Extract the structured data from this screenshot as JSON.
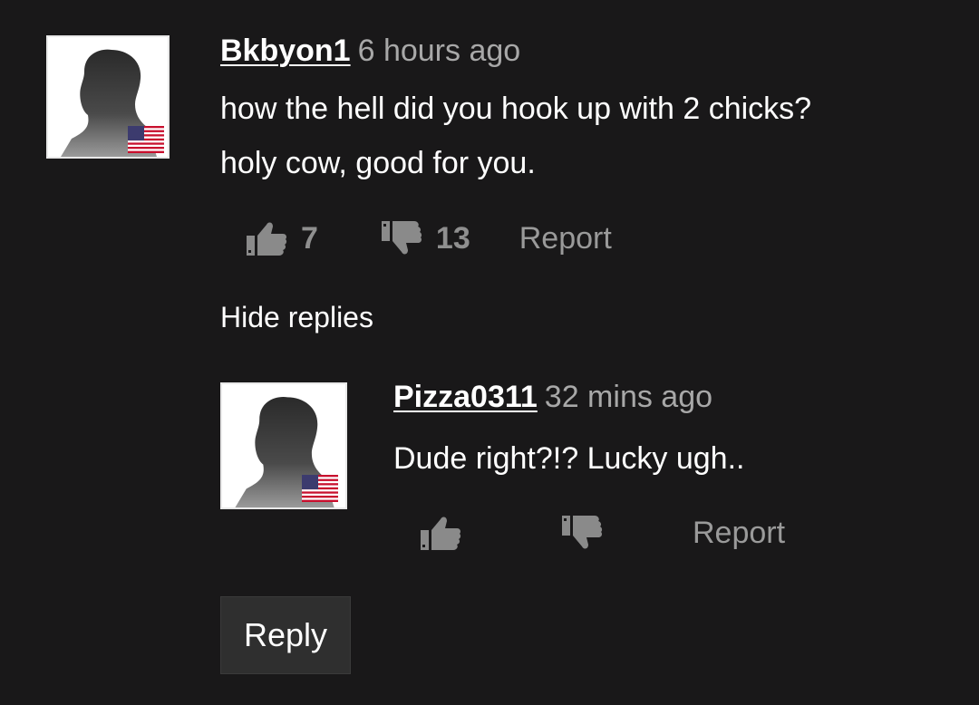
{
  "comment": {
    "username": "Bkbyon1",
    "timestamp": "6 hours ago",
    "text_line1": "how the hell did you hook up with 2 chicks?",
    "text_line2": "holy cow, good for you.",
    "likes": "7",
    "dislikes": "13",
    "report_label": "Report",
    "flag": "us-flag"
  },
  "hide_replies_label": "Hide replies",
  "reply": {
    "username": "Pizza0311",
    "timestamp": "32 mins ago",
    "text": "Dude right?!? Lucky ugh..",
    "likes": "",
    "dislikes": "",
    "report_label": "Report",
    "flag": "us-flag"
  },
  "reply_button_label": "Reply",
  "colors": {
    "background": "#191819",
    "muted_text": "#9a9a9a",
    "icon_gray": "#8a8a8a",
    "button_bg": "#2f2f2f"
  }
}
